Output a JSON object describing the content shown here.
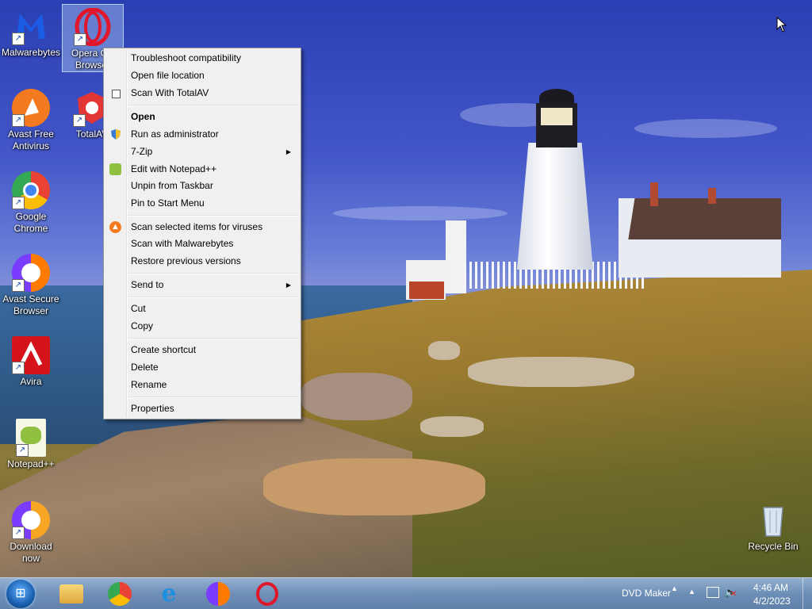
{
  "desktop": {
    "icons": [
      {
        "label": "Malwarebytes",
        "icon": "malwarebytes-icon",
        "color": "#1a5ce6"
      },
      {
        "label": "Opera GX Browser",
        "icon": "opera-icon",
        "color": "#e0162b"
      },
      {
        "label": "Avast Free Antivirus",
        "icon": "avast-icon",
        "color": "#f47a20"
      },
      {
        "label": "TotalAV",
        "icon": "totalav-icon",
        "color": "#e23636"
      },
      {
        "label": "Google Chrome",
        "icon": "chrome-icon",
        "color": "#4285f4"
      },
      {
        "label": "Avast Secure Browser",
        "icon": "avast-secure-browser-icon",
        "color": "#ff7a00"
      },
      {
        "label": "Avira",
        "icon": "avira-icon",
        "color": "#d4131b"
      },
      {
        "label": "Notepad++",
        "icon": "notepadpp-icon",
        "color": "#90c040"
      },
      {
        "label": "Download now",
        "icon": "avast-download-icon",
        "color": "#f6a623"
      },
      {
        "label": "Recycle Bin",
        "icon": "recycle-bin-icon",
        "color": "#c8d8e8"
      }
    ]
  },
  "context_menu": {
    "items": [
      {
        "label": "Troubleshoot compatibility"
      },
      {
        "label": "Open file location"
      },
      {
        "label": "Scan With TotalAV",
        "icon": "totalav-scan-icon"
      },
      {
        "label": "Open"
      },
      {
        "label": "Run as administrator",
        "icon": "uac-shield-icon"
      },
      {
        "label": "7-Zip"
      },
      {
        "label": "Edit with Notepad++",
        "icon": "notepadpp-small-icon"
      },
      {
        "label": "Unpin from Taskbar"
      },
      {
        "label": "Pin to Start Menu"
      },
      {
        "label": "Scan selected items for viruses",
        "icon": "avast-small-icon"
      },
      {
        "label": "Scan with Malwarebytes"
      },
      {
        "label": "Restore previous versions"
      },
      {
        "label": "Send to"
      },
      {
        "label": "Cut"
      },
      {
        "label": "Copy"
      },
      {
        "label": "Create shortcut"
      },
      {
        "label": "Delete"
      },
      {
        "label": "Rename"
      },
      {
        "label": "Properties"
      }
    ]
  },
  "taskbar": {
    "pinned": [
      {
        "icon": "file-explorer-icon"
      },
      {
        "icon": "chrome-icon"
      },
      {
        "icon": "internet-explorer-icon"
      },
      {
        "icon": "avast-secure-browser-icon"
      },
      {
        "icon": "opera-icon"
      }
    ],
    "tray": {
      "app_label": "DVD Maker",
      "time": "4:46 AM",
      "date": "4/2/2023"
    }
  },
  "colors": {
    "menu_bg": "#f0f0f0",
    "taskbar": "#6e91be",
    "selection": "#aac8f0"
  }
}
